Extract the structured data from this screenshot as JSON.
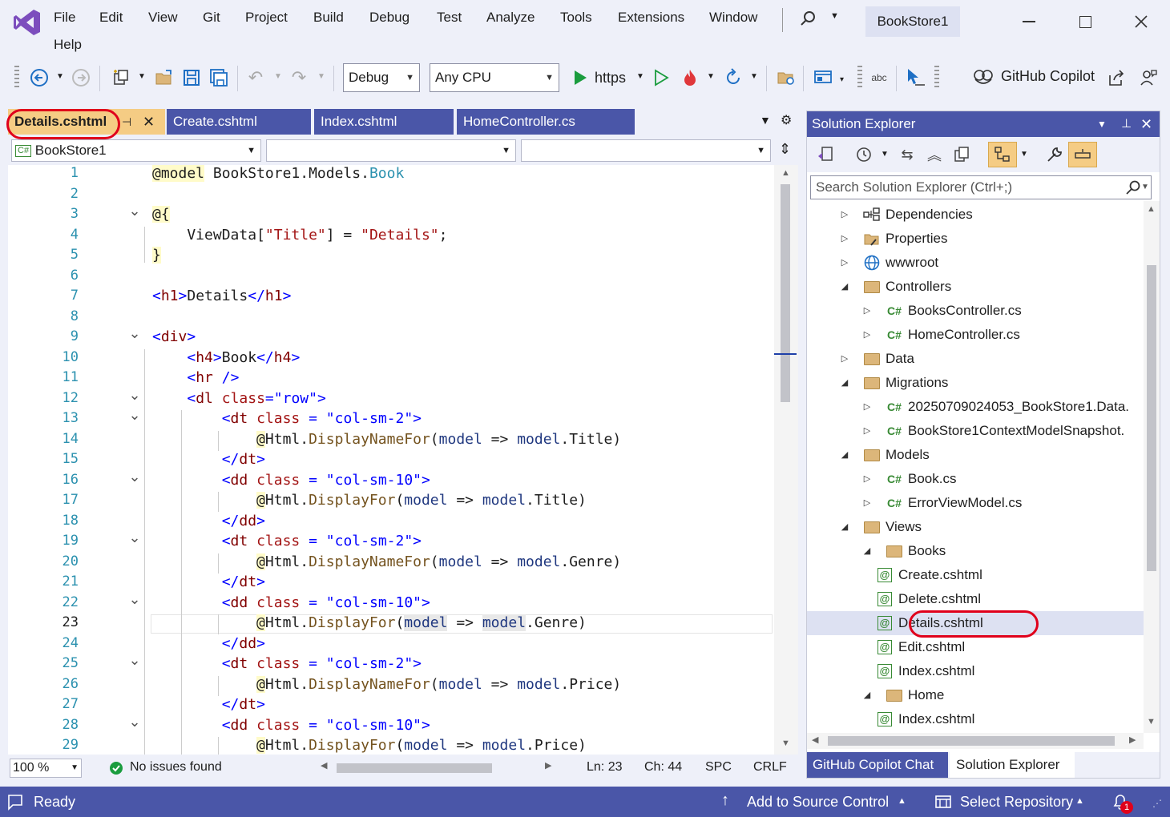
{
  "menu": {
    "items": [
      "File",
      "Edit",
      "View",
      "Git",
      "Project",
      "Build",
      "Debug",
      "Test",
      "Analyze",
      "Tools",
      "Extensions",
      "Window"
    ],
    "help": "Help",
    "project_title": "BookStore1"
  },
  "toolbar": {
    "configuration": "Debug",
    "platform": "Any CPU",
    "run_target": "https",
    "copilot_label": "GitHub Copilot"
  },
  "editor_tabs": [
    {
      "label": "Details.cshtml",
      "active": true
    },
    {
      "label": "Create.cshtml"
    },
    {
      "label": "Index.cshtml"
    },
    {
      "label": "HomeController.cs"
    }
  ],
  "navbar": {
    "project": "BookStore1",
    "project_icon": "C#"
  },
  "code": {
    "line_numbers": [
      "1",
      "2",
      "3",
      "4",
      "5",
      "6",
      "7",
      "8",
      "9",
      "10",
      "11",
      "12",
      "13",
      "14",
      "15",
      "16",
      "17",
      "18",
      "19",
      "20",
      "21",
      "22",
      "23",
      "24",
      "25",
      "26",
      "27",
      "28",
      "29"
    ],
    "current_line": 23
  },
  "editor_status": {
    "zoom": "100 %",
    "issues": "No issues found",
    "line": "Ln: 23",
    "col": "Ch: 44",
    "spacing": "SPC",
    "eol": "CRLF"
  },
  "solution_explorer": {
    "title": "Solution Explorer",
    "search_placeholder": "Search Solution Explorer (Ctrl+;)",
    "items": [
      {
        "label": "Dependencies",
        "kind": "deps",
        "level": 0,
        "expanded": false
      },
      {
        "label": "Properties",
        "kind": "props",
        "level": 0,
        "expanded": false
      },
      {
        "label": "wwwroot",
        "kind": "web",
        "level": 0,
        "expanded": false
      },
      {
        "label": "Controllers",
        "kind": "folder",
        "level": 0,
        "expanded": true
      },
      {
        "label": "BooksController.cs",
        "kind": "cs",
        "level": 1,
        "expanded": false
      },
      {
        "label": "HomeController.cs",
        "kind": "cs",
        "level": 1,
        "expanded": false
      },
      {
        "label": "Data",
        "kind": "folder",
        "level": 0,
        "expanded": false
      },
      {
        "label": "Migrations",
        "kind": "folder",
        "level": 0,
        "expanded": true
      },
      {
        "label": "20250709024053_BookStore1.Data.",
        "kind": "cs",
        "level": 1,
        "expanded": false
      },
      {
        "label": "BookStore1ContextModelSnapshot.",
        "kind": "cs",
        "level": 1,
        "expanded": false
      },
      {
        "label": "Models",
        "kind": "folder",
        "level": 0,
        "expanded": true
      },
      {
        "label": "Book.cs",
        "kind": "cs",
        "level": 1,
        "expanded": false
      },
      {
        "label": "ErrorViewModel.cs",
        "kind": "cs",
        "level": 1,
        "expanded": false
      },
      {
        "label": "Views",
        "kind": "folder",
        "level": 0,
        "expanded": true
      },
      {
        "label": "Books",
        "kind": "folder",
        "level": 1,
        "expanded": true
      },
      {
        "label": "Create.cshtml",
        "kind": "razor",
        "level": 2
      },
      {
        "label": "Delete.cshtml",
        "kind": "razor",
        "level": 2
      },
      {
        "label": "Details.cshtml",
        "kind": "razor",
        "level": 2,
        "selected": true
      },
      {
        "label": "Edit.cshtml",
        "kind": "razor",
        "level": 2
      },
      {
        "label": "Index.cshtml",
        "kind": "razor",
        "level": 2
      },
      {
        "label": "Home",
        "kind": "folder",
        "level": 1,
        "expanded": true
      },
      {
        "label": "Index.cshtml",
        "kind": "razor",
        "level": 2
      }
    ],
    "bottom_tabs": [
      "GitHub Copilot Chat",
      "Solution Explorer"
    ]
  },
  "statusbar": {
    "ready": "Ready",
    "source_control": "Add to Source Control",
    "repository": "Select Repository",
    "notification_count": "1"
  },
  "colors": {
    "accent": "#4a56a8",
    "active_tab": "#f5cc84",
    "annotation": "#e0001b"
  }
}
